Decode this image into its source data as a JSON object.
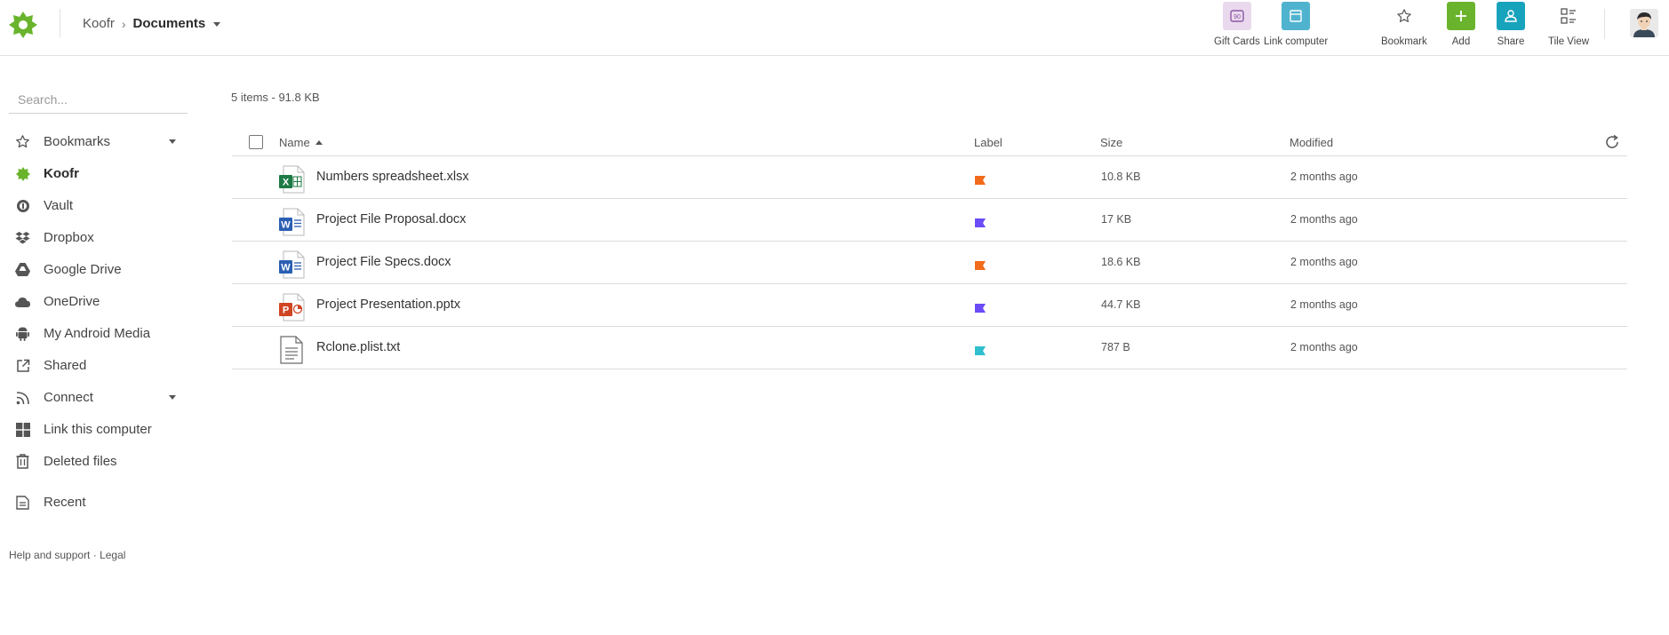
{
  "header": {
    "breadcrumb": {
      "root": "Koofr",
      "separator": "›",
      "current": "Documents"
    },
    "tools": [
      {
        "id": "gift",
        "label": "Gift Cards",
        "icon": "gift-card-icon",
        "bg": "#ead9ee",
        "fg": "#8a5aa3"
      },
      {
        "id": "link",
        "label": "Link computer",
        "icon": "laptop-icon",
        "bg": "#4fb3cf",
        "fg": "#ffffff"
      },
      {
        "id": "bookmark",
        "label": "Bookmark",
        "icon": "star-icon",
        "bg": "transparent",
        "fg": "#555555"
      },
      {
        "id": "add",
        "label": "Add",
        "icon": "plus-icon",
        "bg": "#6ab42d",
        "fg": "#ffffff"
      },
      {
        "id": "share",
        "label": "Share",
        "icon": "share-user-icon",
        "bg": "#18a3bd",
        "fg": "#ffffff"
      },
      {
        "id": "tile",
        "label": "Tile View",
        "icon": "tile-view-icon",
        "bg": "transparent",
        "fg": "#555555"
      }
    ]
  },
  "sidebar": {
    "search_placeholder": "Search...",
    "items": [
      {
        "label": "Bookmarks",
        "icon": "star-outline-icon",
        "caret": true,
        "active": false
      },
      {
        "label": "Koofr",
        "icon": "koofr-icon",
        "caret": false,
        "active": true
      },
      {
        "label": "Vault",
        "icon": "vault-icon",
        "caret": false,
        "active": false
      },
      {
        "label": "Dropbox",
        "icon": "dropbox-icon",
        "caret": false,
        "active": false
      },
      {
        "label": "Google Drive",
        "icon": "google-drive-icon",
        "caret": false,
        "active": false
      },
      {
        "label": "OneDrive",
        "icon": "cloud-icon",
        "caret": false,
        "active": false
      },
      {
        "label": "My Android Media",
        "icon": "android-icon",
        "caret": false,
        "active": false
      },
      {
        "label": "Shared",
        "icon": "external-link-icon",
        "caret": false,
        "active": false
      },
      {
        "label": "Connect",
        "icon": "rss-icon",
        "caret": true,
        "active": false
      },
      {
        "label": "Link this computer",
        "icon": "windows-icon",
        "caret": false,
        "active": false
      },
      {
        "label": "Deleted files",
        "icon": "trash-icon",
        "caret": false,
        "active": false
      },
      {
        "label": "Recent",
        "icon": "recent-files-icon",
        "caret": false,
        "active": false
      }
    ],
    "footer": {
      "help": "Help and support",
      "dot": " · ",
      "legal": "Legal"
    }
  },
  "main": {
    "summary": "5 items - 91.8 KB",
    "columns": {
      "name": "Name",
      "label": "Label",
      "size": "Size",
      "modified": "Modified"
    },
    "files": [
      {
        "name": "Numbers spreadsheet.xlsx",
        "type": "xlsx",
        "icon": "excel-file-icon",
        "label_color": "#f26a1b",
        "size": "10.8 KB",
        "modified": "2 months ago"
      },
      {
        "name": "Project File Proposal.docx",
        "type": "docx",
        "icon": "word-file-icon",
        "label_color": "#6b4cf6",
        "size": "17 KB",
        "modified": "2 months ago"
      },
      {
        "name": "Project File Specs.docx",
        "type": "docx",
        "icon": "word-file-icon",
        "label_color": "#f26a1b",
        "size": "18.6 KB",
        "modified": "2 months ago"
      },
      {
        "name": "Project Presentation.pptx",
        "type": "pptx",
        "icon": "powerpoint-file-icon",
        "label_color": "#6b4cf6",
        "size": "44.7 KB",
        "modified": "2 months ago"
      },
      {
        "name": "Rclone.plist.txt",
        "type": "txt",
        "icon": "text-file-icon",
        "label_color": "#2fbfcf",
        "size": "787 B",
        "modified": "2 months ago"
      }
    ]
  }
}
